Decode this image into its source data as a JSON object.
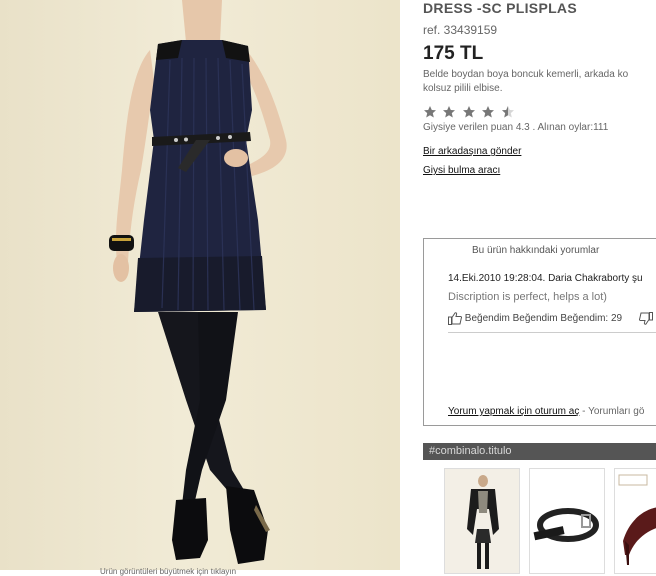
{
  "product": {
    "title": "DRESS -SC PLISPLAS",
    "ref": "ref. 33439159",
    "price": "175 TL",
    "description_line1": "Belde boydan boya boncuk kemerli, arkada ko",
    "description_line2": "kolsuz pilili elbise.",
    "photo_caption": "Ürün görüntüleri büyütmek için tıklayın"
  },
  "rating": {
    "value": 4.3,
    "max": 5,
    "text": "Giysiye verilen puan 4.3 . Alınan oylar:111"
  },
  "links": {
    "send_friend": "Bir arkadaşına gönder",
    "size_guide": "Giysi bulma aracı"
  },
  "comments": {
    "heading": "Bu ürün hakkındaki yorumlar",
    "items": [
      {
        "meta": "14.Eki.2010 19:28:04. Daria Chakraborty şu",
        "text": "Discription is perfect, helps a lot)",
        "like_text": "Beğendim Beğendim Beğendim: 29"
      }
    ],
    "login_link": "Yorum yapmak için oturum aç",
    "footer_rest": " - Yorumları gö"
  },
  "combo": {
    "title": "#combinalo.titulo",
    "thumbs": [
      "coat-outfit",
      "belt",
      "red-heel-shoe"
    ]
  },
  "colors": {
    "dress": "#1f2440",
    "background": "#efe8d2",
    "combo_bar": "#555555"
  }
}
